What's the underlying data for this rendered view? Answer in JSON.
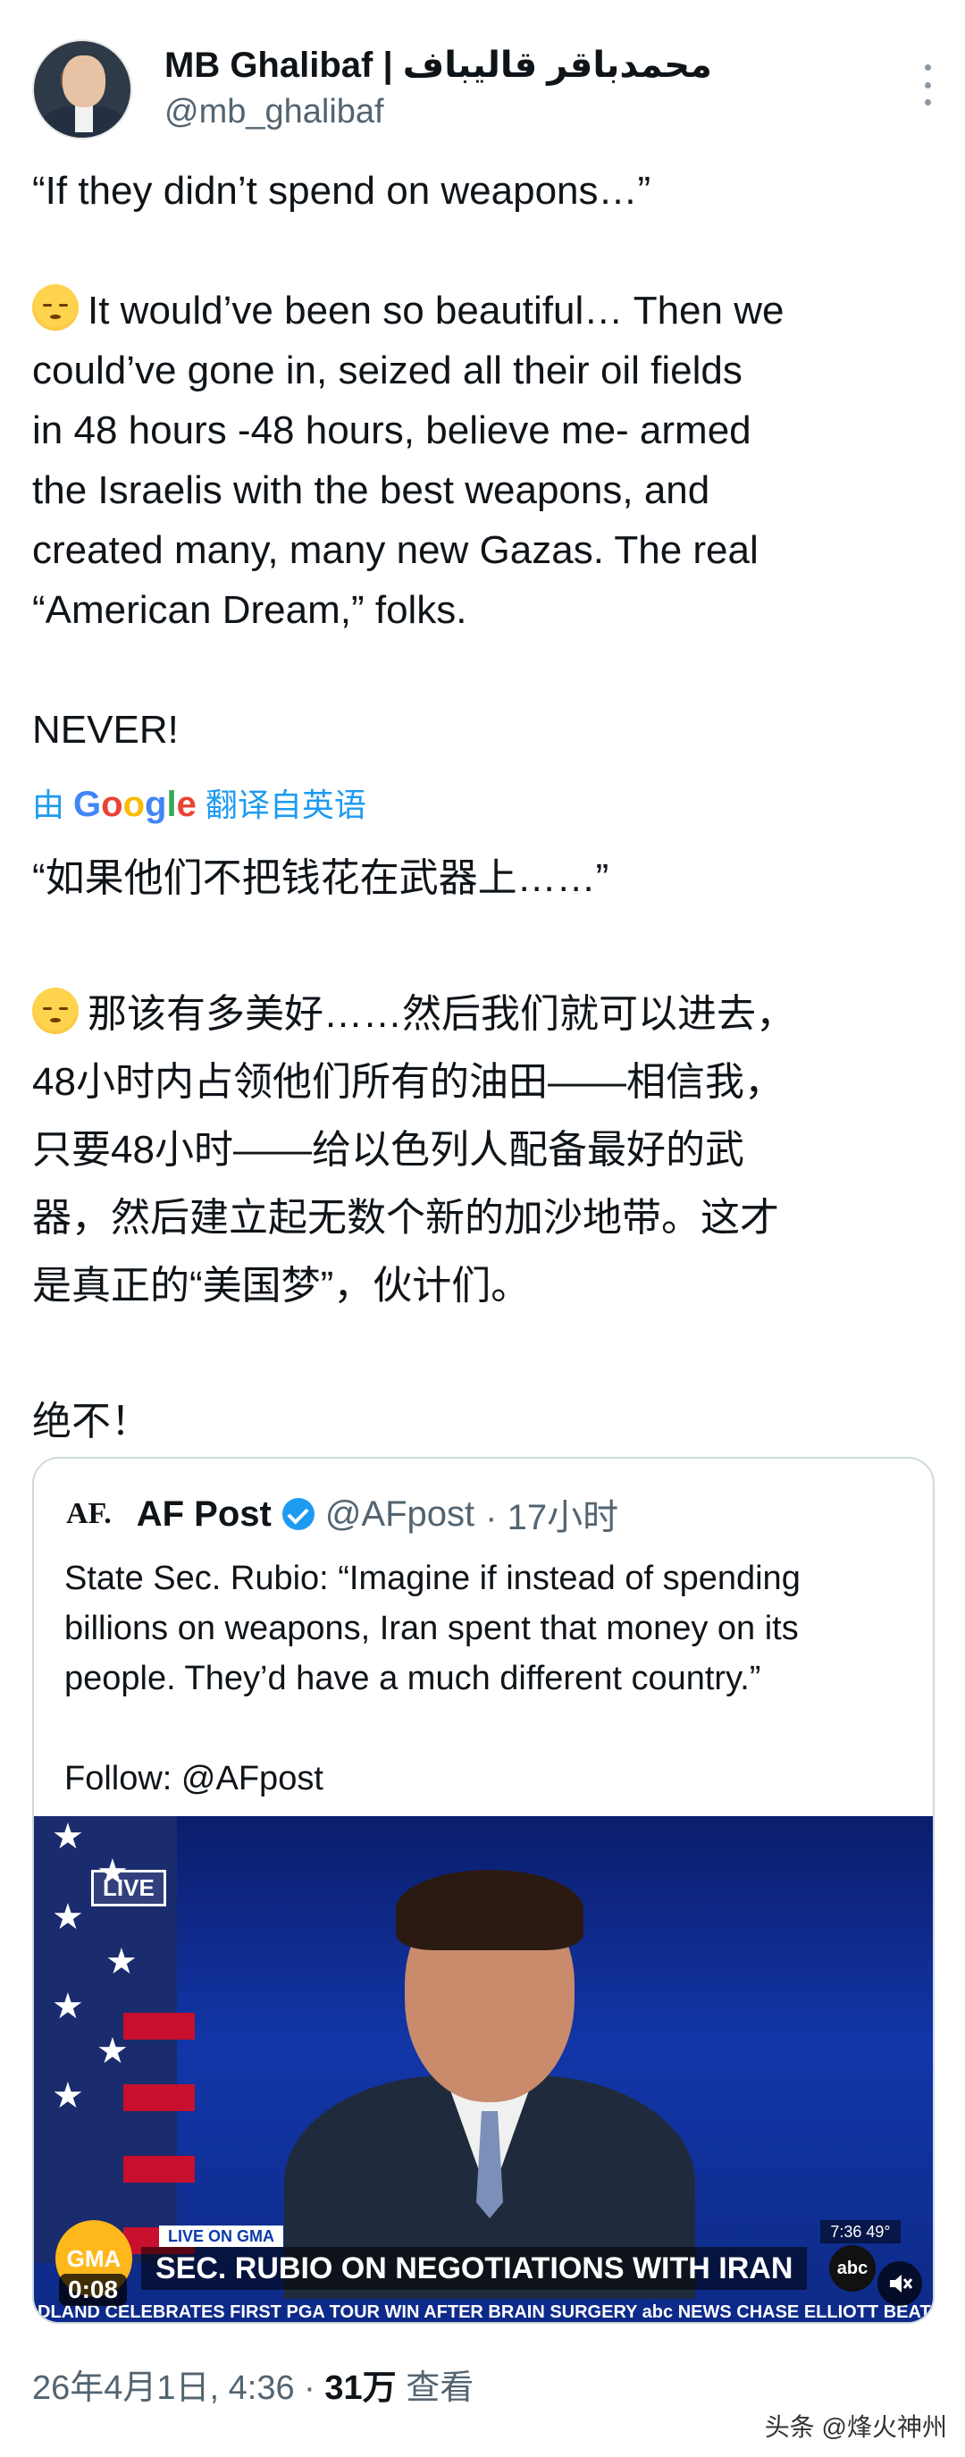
{
  "author": {
    "name": "MB Ghalibaf | محمدباقر قالیباف",
    "handle": "@mb_ghalibaf"
  },
  "tweet_lines": [
    "“If they didn’t spend on weapons…”",
    "",
    "It would’ve been so beautiful… Then we",
    "could’ve gone in, seized all their oil fields",
    "in 48 hours -48 hours, believe me- armed",
    "the Israelis with the best weapons, and",
    "created many, many new Gazas. The real",
    "“American Dream,” folks.",
    "",
    "NEVER!"
  ],
  "translate": {
    "prefix": "由",
    "brand": "Google",
    "suffix": "翻译自英语"
  },
  "translation_lines": [
    "“如果他们不把钱花在武器上……”",
    "",
    "那该有多美好……然后我们就可以进去，",
    "48小时内占领他们所有的油田——相信我，",
    "只要48小时——给以色列人配备最好的武",
    "器，然后建立起无数个新的加沙地带。这才",
    "是真正的“美国梦”，伙计们。",
    "",
    "绝不！"
  ],
  "quote": {
    "logo_text": "AF.",
    "name": "AF Post",
    "handle": "@AFpost",
    "time": "· 17小时",
    "lines": [
      "State Sec. Rubio: “Imagine if instead of spending",
      "billions on weapons, Iran spent that money on its",
      "people. They’d have a much different country.”",
      "",
      "Follow: @AFpost"
    ]
  },
  "video": {
    "live_label": "LIVE",
    "gma": "GMA",
    "live_on": "LIVE ON GMA",
    "headline": "SEC. RUBIO ON NEGOTIATIONS WITH IRAN",
    "ticker": "DLAND CELEBRATES FIRST PGA TOUR WIN AFTER BRAIN SURGERY    abc NEWS    CHASE ELLIOTT BEATS DENN",
    "clock": "7:36  49°",
    "abc": "abc",
    "duration": "0:08"
  },
  "meta": {
    "date": "26年4月1日, 4:36 ·",
    "views": "31万",
    "views_label": "查看"
  },
  "watermark": "头条 @烽火神州"
}
